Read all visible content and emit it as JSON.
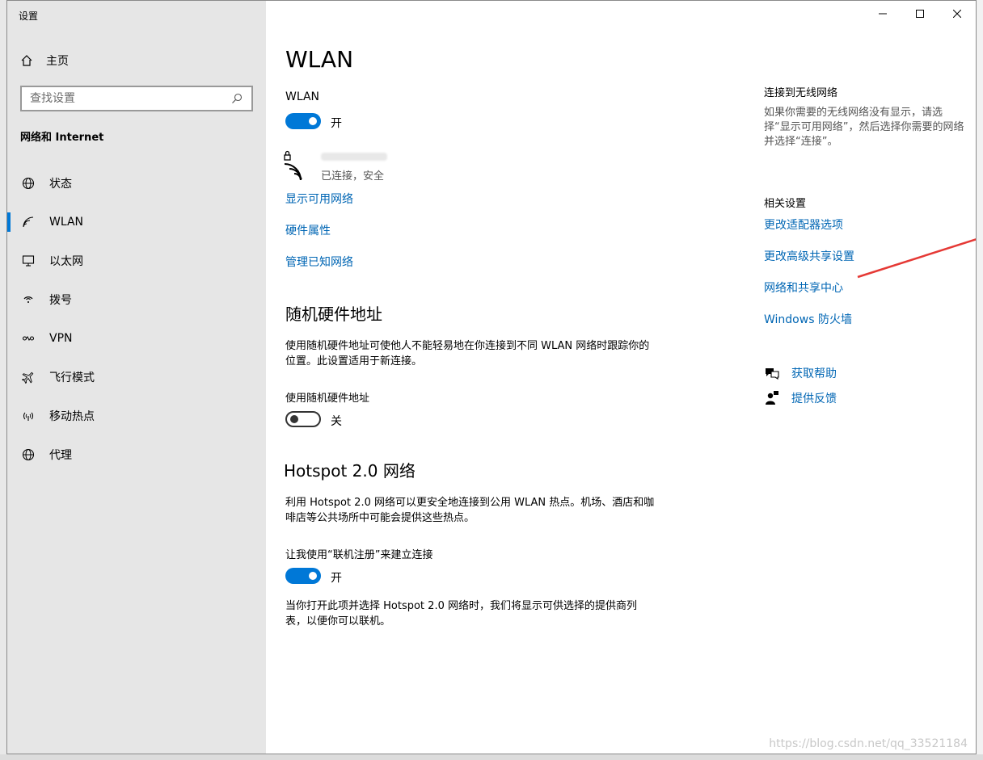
{
  "window": {
    "title": "设置"
  },
  "sidebar": {
    "home_label": "主页",
    "search_placeholder": "查找设置",
    "section_heading": "网络和 Internet",
    "items": [
      {
        "label": "状态",
        "icon": "globe-icon"
      },
      {
        "label": "WLAN",
        "icon": "wifi-icon",
        "active": true
      },
      {
        "label": "以太网",
        "icon": "ethernet-icon"
      },
      {
        "label": "拨号",
        "icon": "dialup-icon"
      },
      {
        "label": "VPN",
        "icon": "vpn-icon"
      },
      {
        "label": "飞行模式",
        "icon": "airplane-icon"
      },
      {
        "label": "移动热点",
        "icon": "hotspot-icon"
      },
      {
        "label": "代理",
        "icon": "globe-icon"
      }
    ]
  },
  "main": {
    "page_title": "WLAN",
    "wlan_label": "WLAN",
    "wlan_state": "开",
    "network_status": "已连接，安全",
    "links": {
      "show_networks": "显示可用网络",
      "hardware_props": "硬件属性",
      "manage_known": "管理已知网络"
    },
    "random_mac": {
      "heading": "随机硬件地址",
      "desc": "使用随机硬件地址可使他人不能轻易地在你连接到不同 WLAN 网络时跟踪你的位置。此设置适用于新连接。",
      "toggle_label": "使用随机硬件地址",
      "state": "关"
    },
    "hotspot": {
      "heading": "Hotspot 2.0 网络",
      "desc": "利用 Hotspot 2.0 网络可以更安全地连接到公用 WLAN 热点。机场、酒店和咖啡店等公共场所中可能会提供这些热点。",
      "toggle_label": "让我使用“联机注册”来建立连接",
      "state": "开",
      "note": "当你打开此项并选择 Hotspot 2.0 网络时，我们将显示可供选择的提供商列表，以便你可以联机。"
    }
  },
  "right_panel": {
    "connect_title": "连接到无线网络",
    "connect_desc": "如果你需要的无线网络没有显示，请选择“显示可用网络”，然后选择你需要的网络并选择“连接”。",
    "related_title": "相关设置",
    "related_links": [
      "更改适配器选项",
      "更改高级共享设置",
      "网络和共享中心",
      "Windows 防火墙"
    ],
    "help": "获取帮助",
    "feedback": "提供反馈"
  },
  "annotation": {
    "arrow_color": "#e53935"
  },
  "watermark": "https://blog.csdn.net/qq_33521184",
  "colors": {
    "accent": "#0078d7",
    "link": "#0066b4",
    "sidebar_bg": "#e6e6e6"
  }
}
